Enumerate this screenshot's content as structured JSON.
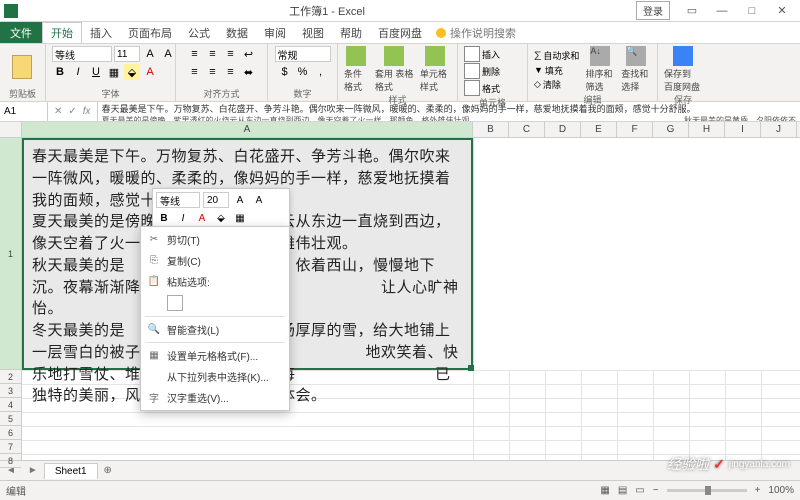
{
  "titlebar": {
    "title": "工作簿1 - Excel",
    "login": "登录"
  },
  "menu": {
    "file": "文件",
    "tabs": [
      "开始",
      "插入",
      "页面布局",
      "公式",
      "数据",
      "审阅",
      "视图",
      "帮助",
      "百度网盘"
    ],
    "tellme": "操作说明搜索"
  },
  "ribbon": {
    "clipboard": "剪贴板",
    "font": {
      "label": "字体",
      "name": "等线",
      "size": "11",
      "bold": "B",
      "italic": "I",
      "underline": "U"
    },
    "align": "对齐方式",
    "number": "数字",
    "styles": {
      "label": "样式",
      "cond": "条件格式",
      "table": "套用\n表格格式",
      "cell": "单元格样式"
    },
    "cells": {
      "label": "单元格",
      "insert": "插入",
      "delete": "删除",
      "format": "格式"
    },
    "editing": {
      "label": "编辑",
      "sum": "自动求和",
      "fill": "填充",
      "clear": "清除",
      "sort": "排序和筛选",
      "find": "查找和选择"
    },
    "save": {
      "label": "保存",
      "btn": "保存到\n百度网盘"
    }
  },
  "fbar": {
    "name": "A1",
    "line1": "春天最美是下午。万物复苏、白花盛开、争芳斗艳。偶尔吹来一阵微风，暖暖的、柔柔的，像妈妈的手一样，慈爱地抚摸着我的面颊，感觉十分舒服。",
    "line2a": "夏天最美的是傍晚。紫里透红的火烧云从东边一直烧到西边，像天空着了火一样，那颜色，格外雄伟壮观。",
    "line2b": "秋天最美的是黄昏。夕阳依依不",
    "line3a": "舍西山，慢慢地下沉。夜幕渐渐降临，那风声、虫鸣，听起来让人心旷神怡。",
    "line3b": "冬天最美的是中午。下过一场厚厚的雪，给大地铺"
  },
  "a1_text": "春天最美是下午。万物复苏、白花盛开、争芳斗艳。偶尔吹来一阵微风，暖暖的、柔柔的，像妈妈的手一样，慈爱地抚摸着我的面颊，感觉十分\n夏天最美的是傍晚。紫里透红的火烧云从东边一直烧到西边，像天空着了火一样　　　　　　　　雄伟壮观。\n秋天最美的是　　　　　　　　　　　依着西山，慢慢地下沉。夜幕渐渐降临，那风声、　　　　　　　　　　让人心旷神怡。\n冬天最美的是　　　　　　　　　　场厚厚的雪，给大地铺上一层雪白的被子。孩子们、　　　　　　　　　　地欢笑着、快乐地打雪仗、堆雪人，多么快乐啊。每　　　　　　　　　已独特的美丽，风景人情，需要用心来体会。",
  "cols": [
    "A",
    "B",
    "C",
    "D",
    "E",
    "F",
    "G",
    "H",
    "I",
    "J"
  ],
  "rows": [
    "1",
    "2",
    "3",
    "4",
    "5",
    "6",
    "7",
    "8"
  ],
  "mini": {
    "font": "等线",
    "size": "20",
    "b": "B",
    "i": "I",
    "a": "A"
  },
  "ctx": {
    "cut": "剪切(T)",
    "copy": "复制(C)",
    "paste_label": "粘贴选项:",
    "smart": "智能查找(L)",
    "cellformat": "设置单元格格式(F)...",
    "fromlist": "从下拉列表中选择(K)...",
    "pinyin": "汉字重选(V)..."
  },
  "sheet": {
    "name": "Sheet1"
  },
  "status": {
    "mode": "编辑",
    "zoom": "100%"
  },
  "watermark": {
    "brand": "经验啦",
    "url": "jingyanla.com"
  }
}
